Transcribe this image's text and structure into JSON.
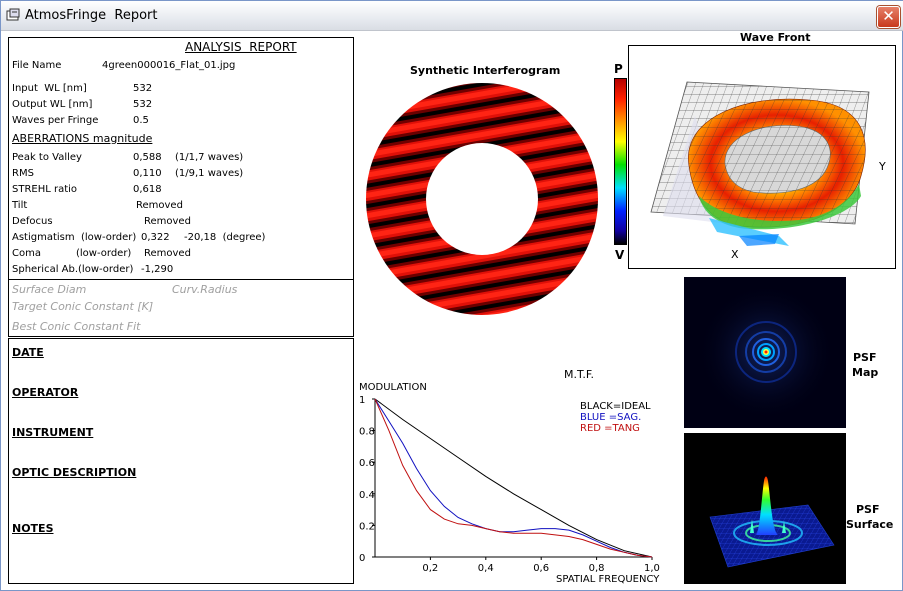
{
  "window": {
    "title": "AtmosFringe  Report",
    "close_glyph": "✕"
  },
  "report": {
    "heading": "ANALYSIS  REPORT",
    "file_name_label": "File Name",
    "file_name_value": "4green000016_Flat_01.jpg",
    "input_wl_label": "Input  WL [nm]",
    "input_wl_value": "532",
    "output_wl_label": "Output WL [nm]",
    "output_wl_value": "532",
    "waves_label": "Waves per Fringe",
    "waves_value": "0.5",
    "aberrations_heading": "ABERRATIONS magnitude",
    "ptv_label": "Peak to Valley",
    "ptv_value": "0,588",
    "ptv_waves": "(1/1,7 waves)",
    "rms_label": "RMS",
    "rms_value": "0,110",
    "rms_waves": "(1/9,1 waves)",
    "strehl_label": "STREHL ratio",
    "strehl_value": "0,618",
    "tilt_label": "Tilt",
    "tilt_value": "Removed",
    "defocus_label": "Defocus",
    "defocus_value": "Removed",
    "astig_label": "Astigmatism  (low-order)",
    "astig_value": "0,322",
    "astig_degree": "-20,18  (degree)",
    "coma_label": "Coma",
    "coma_order": "(low-order)",
    "coma_value": "Removed",
    "spherical_label": "Spherical Ab.(low-order)",
    "spherical_value": "-1,290",
    "surface_diam": "Surface Diam",
    "curv_radius": "Curv.Radius",
    "target_conic": "Target Conic Constant [K]",
    "best_conic": "Best Conic Constant Fit"
  },
  "notes": {
    "date": "DATE",
    "operator": "OPERATOR",
    "instrument": "INSTRUMENT",
    "optic_description": "OPTIC DESCRIPTION",
    "notes": "NOTES"
  },
  "interferogram": {
    "title": "Synthetic Interferogram"
  },
  "colorbar": {
    "top_label": "P",
    "bottom_label": "V"
  },
  "wavefront": {
    "title": "Wave Front",
    "x_label": "X",
    "y_label": "Y"
  },
  "psf": {
    "map_label_1": "PSF",
    "map_label_2": "Map",
    "surface_label_1": "PSF",
    "surface_label_2": "Surface"
  },
  "chart_data": {
    "type": "line",
    "title": "M.T.F.",
    "ylabel": "MODULATION",
    "xlabel": "SPATIAL FREQUENCY",
    "xlim": [
      0,
      1
    ],
    "ylim": [
      0,
      1
    ],
    "x_ticks": [
      "0,2",
      "0,4",
      "0,6",
      "0,8",
      "1,0"
    ],
    "y_ticks": [
      "1",
      "0.8",
      "0.6",
      "0.4",
      "0.2",
      "0"
    ],
    "legend": [
      "BLACK=IDEAL",
      "BLUE  =SAG.",
      "RED    =TANG"
    ],
    "legend_position": "top-right",
    "series": [
      {
        "name": "IDEAL",
        "color": "#000000",
        "x": [
          0,
          0.1,
          0.2,
          0.3,
          0.4,
          0.5,
          0.6,
          0.7,
          0.8,
          0.9,
          1.0
        ],
        "y": [
          1.0,
          0.87,
          0.75,
          0.63,
          0.51,
          0.4,
          0.3,
          0.2,
          0.11,
          0.04,
          0.0
        ]
      },
      {
        "name": "SAG.",
        "color": "#1010c0",
        "x": [
          0,
          0.05,
          0.1,
          0.15,
          0.2,
          0.25,
          0.3,
          0.35,
          0.4,
          0.45,
          0.5,
          0.55,
          0.6,
          0.65,
          0.7,
          0.75,
          0.8,
          0.85,
          0.9,
          0.95,
          1.0
        ],
        "y": [
          1.0,
          0.86,
          0.72,
          0.56,
          0.42,
          0.32,
          0.25,
          0.21,
          0.18,
          0.16,
          0.16,
          0.17,
          0.18,
          0.18,
          0.17,
          0.14,
          0.1,
          0.06,
          0.03,
          0.01,
          0.0
        ]
      },
      {
        "name": "TANG",
        "color": "#c01010",
        "x": [
          0,
          0.05,
          0.1,
          0.15,
          0.2,
          0.25,
          0.3,
          0.35,
          0.4,
          0.45,
          0.5,
          0.55,
          0.6,
          0.65,
          0.7,
          0.75,
          0.8,
          0.85,
          0.9,
          0.95,
          1.0
        ],
        "y": [
          1.0,
          0.8,
          0.58,
          0.42,
          0.3,
          0.24,
          0.21,
          0.2,
          0.18,
          0.16,
          0.15,
          0.15,
          0.15,
          0.14,
          0.13,
          0.11,
          0.08,
          0.05,
          0.03,
          0.01,
          0.0
        ]
      }
    ]
  }
}
